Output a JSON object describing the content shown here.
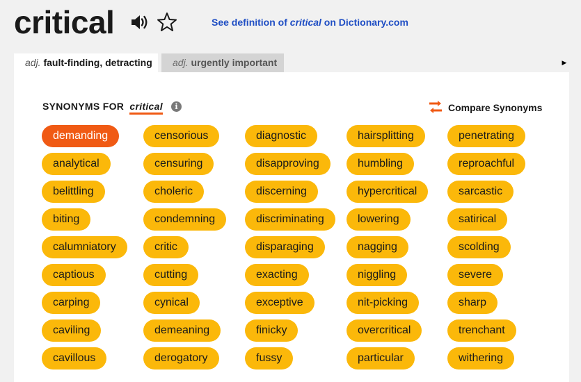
{
  "header": {
    "word": "critical",
    "dictionary_link": {
      "prefix": "See definition of ",
      "word": "critical",
      "suffix": " on Dictionary.com"
    }
  },
  "tabs": [
    {
      "pos": "adj.",
      "label": "fault-finding, detracting",
      "active": true
    },
    {
      "pos": "adj.",
      "label": "urgently important",
      "active": false
    }
  ],
  "synonyms_section": {
    "heading": "SYNONYMS FOR",
    "headword": "critical",
    "info_glyph": "i",
    "compare_label": "Compare Synonyms"
  },
  "synonym_columns": [
    [
      "demanding",
      "analytical",
      "belittling",
      "biting",
      "calumniatory",
      "captious",
      "carping",
      "caviling",
      "cavillous"
    ],
    [
      "censorious",
      "censuring",
      "choleric",
      "condemning",
      "critic",
      "cutting",
      "cynical",
      "demeaning",
      "derogatory"
    ],
    [
      "diagnostic",
      "disapproving",
      "discerning",
      "discriminating",
      "disparaging",
      "exacting",
      "exceptive",
      "finicky",
      "fussy"
    ],
    [
      "hairsplitting",
      "humbling",
      "hypercritical",
      "lowering",
      "nagging",
      "niggling",
      "nit-picking",
      "overcritical",
      "particular"
    ],
    [
      "penetrating",
      "reproachful",
      "sarcastic",
      "satirical",
      "scolding",
      "severe",
      "sharp",
      "trenchant",
      "withering"
    ]
  ],
  "selected_synonym": "demanding",
  "colors": {
    "pill": "#fbb80a",
    "pill_selected": "#f05a14",
    "link": "#1f4ec4",
    "underline_accent": "#f05a14"
  },
  "icons": [
    "speaker-icon",
    "star-icon",
    "info-icon",
    "compare-arrows-icon",
    "tab-scroll-arrow-icon"
  ]
}
